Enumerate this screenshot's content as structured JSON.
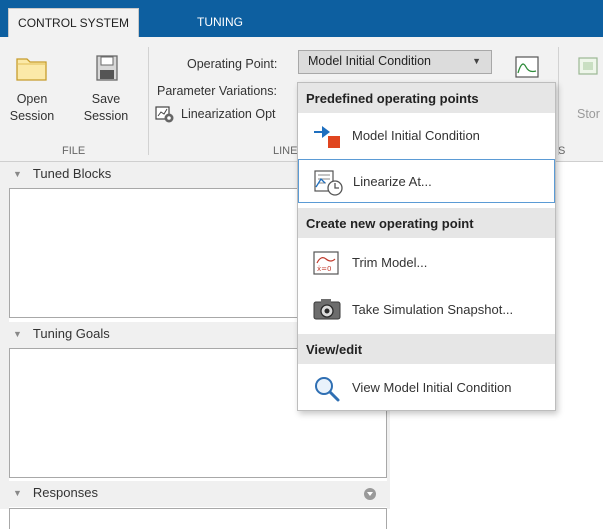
{
  "tabs": [
    {
      "label": "CONTROL SYSTEM",
      "active": true
    },
    {
      "label": "TUNING",
      "active": false
    }
  ],
  "file_section": {
    "open_line1": "Open",
    "open_line2": "Session",
    "save_line1": "Save",
    "save_line2": "Session",
    "label": "FILE"
  },
  "linearization_section": {
    "operating_point_label": "Operating Point:",
    "operating_point_value": "Model Initial Condition",
    "parameter_variations_label": "Parameter Variations:",
    "linearization_options_label": "Linearization Opt",
    "section_label_partial": "LINE",
    "section_label_partial2": "S"
  },
  "right_toolbar": {
    "store_partial": "Stor"
  },
  "panels": {
    "tuned_blocks": "Tuned Blocks",
    "tuning_goals": "Tuning Goals",
    "responses": "Responses"
  },
  "menu": {
    "sections": [
      {
        "title": "Predefined operating points"
      },
      {
        "title": "Create new operating point"
      },
      {
        "title": "View/edit"
      }
    ],
    "items": [
      {
        "label": "Model Initial Condition",
        "icon": "model-initial-condition-icon"
      },
      {
        "label": "Linearize At...",
        "icon": "linearize-at-icon",
        "highlighted": true
      },
      {
        "label": "Trim Model...",
        "icon": "trim-model-icon"
      },
      {
        "label": "Take Simulation Snapshot...",
        "icon": "camera-icon"
      },
      {
        "label": "View Model Initial Condition",
        "icon": "magnifier-icon"
      }
    ]
  },
  "colors": {
    "tab_bar": "#0d5fa0",
    "toolstrip": "#f2f2f2",
    "menu_highlight_border": "#5b9bd5",
    "menu_section_bg": "#e6e6e6"
  }
}
